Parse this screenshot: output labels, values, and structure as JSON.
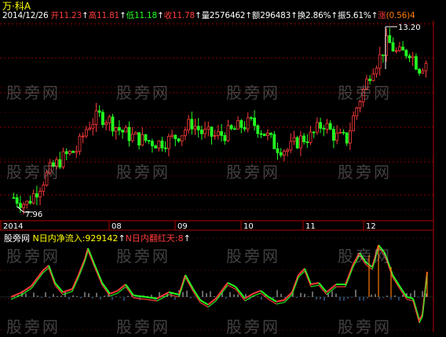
{
  "header": {
    "title_prefix": "万",
    "title_suffix": "·科A",
    "date": "2014/12/26",
    "open_label": "开",
    "open_value": "11.23",
    "high_label": "高",
    "high_value": "11.81",
    "low_label": "低",
    "low_value": "11.18",
    "close_label": "收",
    "close_value": "11.78",
    "volume_label": "量",
    "volume_value": "2576462",
    "amount_label": "额",
    "amount_value": "296483",
    "turnover_label": "换",
    "turnover_value": "2.86%",
    "amplitude_label": "振",
    "amplitude_value": "5.61%",
    "change_label": "涨",
    "change_value": "(0.56)4"
  },
  "price_chart": {
    "high_marker": "13.20",
    "low_marker": "7.96",
    "month_labels": [
      "2014",
      "08",
      "09",
      "10",
      "11",
      "12"
    ]
  },
  "indicator": {
    "name": "股旁网",
    "line1": "N日内净流入:929142",
    "line2": "N日内翻红天:8"
  },
  "watermark": "股旁网",
  "colors": {
    "background": "#000000",
    "up": "#ff3b3b",
    "down": "#22ff22",
    "grid": "#8b0000",
    "accent": "#ffff00"
  }
}
